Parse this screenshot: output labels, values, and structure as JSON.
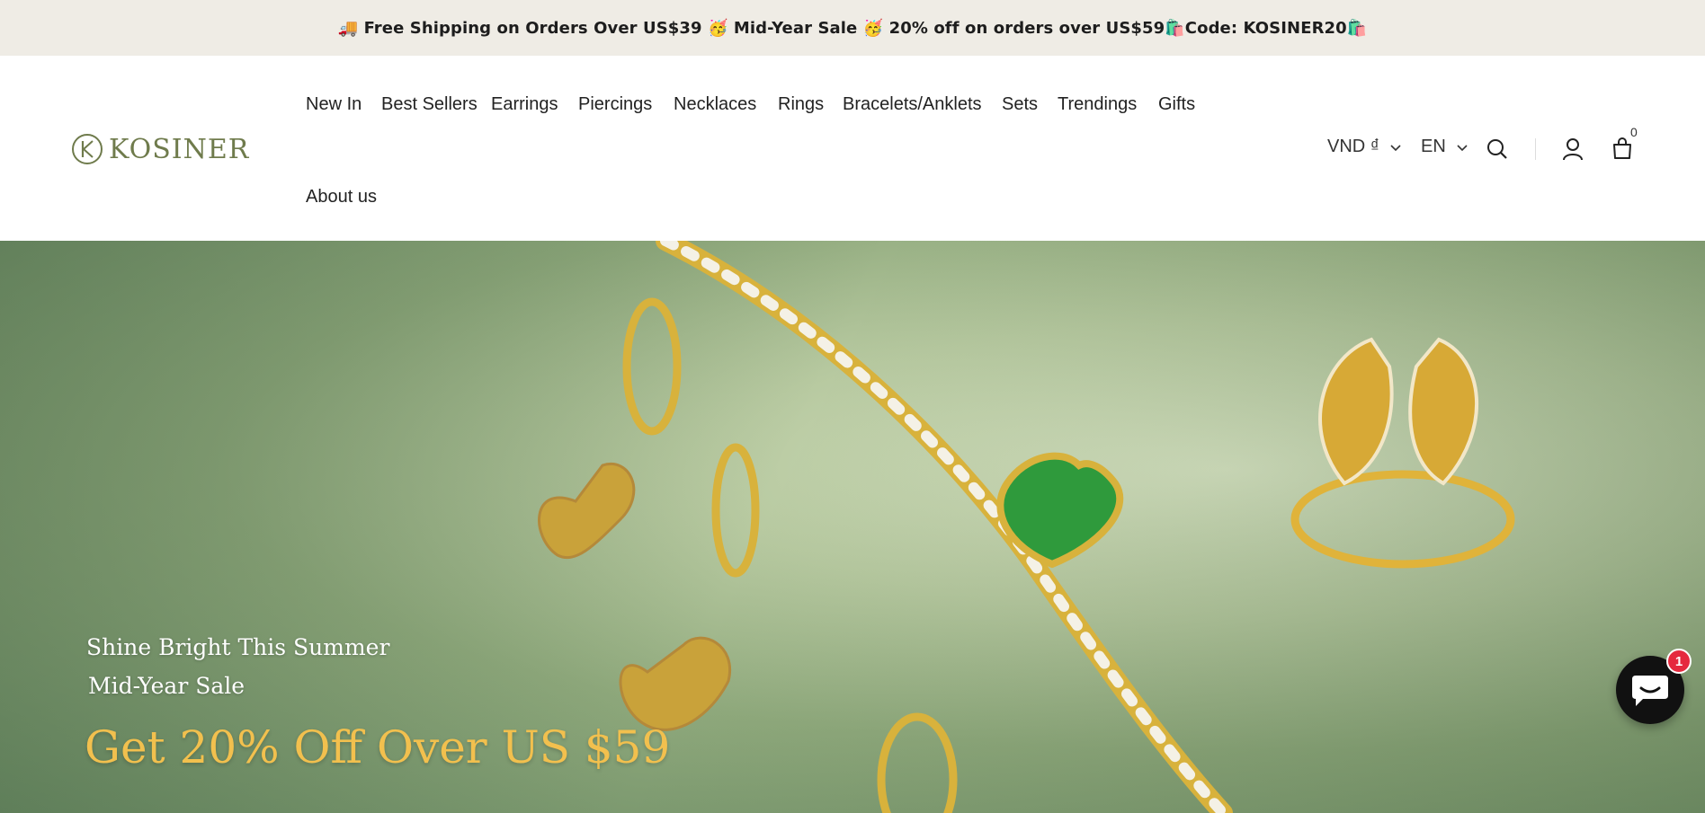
{
  "announcement": {
    "text": "🚚 Free Shipping on Orders Over US$39 🥳 Mid-Year Sale 🥳  20% off on orders over US$59🛍️Code: KOSINER20🛍️"
  },
  "brand": {
    "logo_text": "KOSINER",
    "logo_color": "#6f7b4c"
  },
  "nav": {
    "items": [
      {
        "label": "New In"
      },
      {
        "label": "Best Sellers"
      },
      {
        "label": "Earrings"
      },
      {
        "label": "Piercings"
      },
      {
        "label": "Necklaces"
      },
      {
        "label": "Rings"
      },
      {
        "label": "Bracelets/Anklets"
      },
      {
        "label": "Sets"
      },
      {
        "label": "Trendings"
      },
      {
        "label": "Gifts"
      },
      {
        "label": "About us"
      }
    ]
  },
  "utilities": {
    "currency": "VND ₫",
    "language": "EN",
    "cart_count": "0",
    "icons": [
      "chevron-down-icon",
      "search-icon",
      "account-icon",
      "cart-icon"
    ]
  },
  "hero": {
    "subtitle1": "Shine Bright This Summer",
    "subtitle2": "Mid-Year Sale",
    "title": "Get 20% Off Over US $59",
    "title_color": "#f2c04e"
  },
  "chat": {
    "badge": "1",
    "icon": "chat-icon",
    "badge_color": "#e5293e"
  }
}
